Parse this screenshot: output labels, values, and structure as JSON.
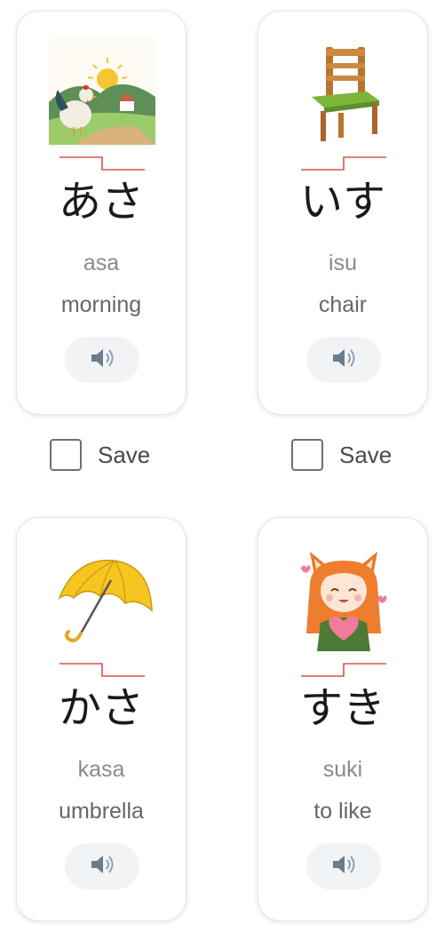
{
  "cards": [
    {
      "word": "あさ",
      "romaji": "asa",
      "meaning": "morning",
      "image_icon": "rooster-sunrise-illustration",
      "audio_icon": "speaker-icon"
    },
    {
      "word": "いす",
      "romaji": "isu",
      "meaning": "chair",
      "image_icon": "wooden-chair-illustration",
      "audio_icon": "speaker-icon"
    },
    {
      "word": "かさ",
      "romaji": "kasa",
      "meaning": "umbrella",
      "image_icon": "yellow-umbrella-illustration",
      "audio_icon": "speaker-icon"
    },
    {
      "word": "すき",
      "romaji": "suki",
      "meaning": "to like",
      "image_icon": "fox-girl-heart-illustration",
      "audio_icon": "speaker-icon"
    }
  ],
  "save_controls": [
    {
      "label": "Save",
      "checked": false
    },
    {
      "label": "Save",
      "checked": false
    }
  ],
  "colors": {
    "pitch_line": "#d9534f",
    "card_border": "#e6e6e6",
    "audio_button_bg": "#f2f3f5"
  }
}
